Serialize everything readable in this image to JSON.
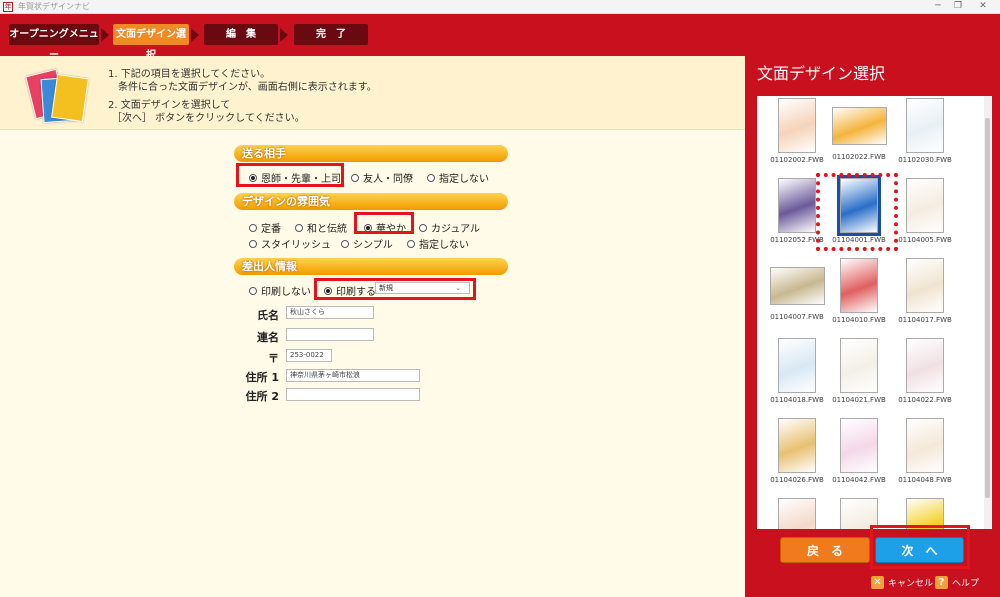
{
  "window": {
    "app_title": "年賀状デザインナビ",
    "minimize": "─",
    "restore": "❐",
    "close": "✕"
  },
  "steps": [
    {
      "label": "オープニングメニュー",
      "active": false
    },
    {
      "label": "文面デザイン選択",
      "active": true
    },
    {
      "label": "編　集",
      "active": false
    },
    {
      "label": "完　了",
      "active": false
    }
  ],
  "instructions": {
    "line1": "1. 下記の項目を選択してください。",
    "line2": "条件に合った文面デザインが、画面右側に表示されます。",
    "line3": "2. 文面デザインを選択して",
    "line4": "［次へ］ ボタンをクリックしてください。"
  },
  "recipient": {
    "title": "送る相手",
    "options": [
      {
        "label": "恩師・先輩・上司",
        "checked": true
      },
      {
        "label": "友人・同僚",
        "checked": false
      },
      {
        "label": "指定しない",
        "checked": false
      }
    ]
  },
  "mood": {
    "title": "デザインの雰囲気",
    "options": [
      {
        "label": "定番",
        "checked": false
      },
      {
        "label": "和と伝統",
        "checked": false
      },
      {
        "label": "華やか",
        "checked": true
      },
      {
        "label": "カジュアル",
        "checked": false
      },
      {
        "label": "スタイリッシュ",
        "checked": false
      },
      {
        "label": "シンプル",
        "checked": false
      },
      {
        "label": "指定しない",
        "checked": false
      }
    ]
  },
  "sender": {
    "title": "差出人情報",
    "no_print": "印刷しない",
    "print": "印刷する",
    "print_selected": true,
    "select_value": "新規",
    "fields": [
      {
        "label": "氏名",
        "value": "秋山さくら"
      },
      {
        "label": "連名",
        "value": ""
      },
      {
        "label": "〒",
        "value": "253-0022"
      },
      {
        "label": "住所 1",
        "value": "神奈川県茅ヶ崎市松浪"
      },
      {
        "label": "住所 2",
        "value": ""
      }
    ]
  },
  "panel": {
    "title": "文面デザイン選択",
    "thumbs": [
      {
        "name": "01102002.FWB",
        "color": "#f6d3b8",
        "land": false
      },
      {
        "name": "01102022.FWB",
        "color": "#f4b43c",
        "land": true
      },
      {
        "name": "01102030.FWB",
        "color": "#e8f0f4",
        "land": false
      },
      {
        "name": "01102052.FWB",
        "color": "#6a5a9a",
        "land": false
      },
      {
        "name": "01104001.FWB",
        "color": "#2a6fc8",
        "land": false,
        "selected": true
      },
      {
        "name": "01104005.FWB",
        "color": "#f4ece0",
        "land": false
      },
      {
        "name": "01104007.FWB",
        "color": "#c8b890",
        "land": true
      },
      {
        "name": "01104010.FWB",
        "color": "#e06060",
        "land": false
      },
      {
        "name": "01104017.FWB",
        "color": "#f0e4d0",
        "land": false
      },
      {
        "name": "01104018.FWB",
        "color": "#d8e8f4",
        "land": false
      },
      {
        "name": "01104021.FWB",
        "color": "#f4f0e8",
        "land": false
      },
      {
        "name": "01104022.FWB",
        "color": "#f0e0e4",
        "land": false
      },
      {
        "name": "01104026.FWB",
        "color": "#e8c070",
        "land": false
      },
      {
        "name": "01104042.FWB",
        "color": "#f4d8e8",
        "land": false
      },
      {
        "name": "01104048.FWB",
        "color": "#f4e8d8",
        "land": false
      },
      {
        "name": "",
        "color": "#f4d8c8",
        "land": false
      },
      {
        "name": "",
        "color": "#f4ece0",
        "land": false
      },
      {
        "name": "",
        "color": "#f4d020",
        "land": false
      }
    ],
    "back": "戻　る",
    "next": "次　へ",
    "cancel": "キャンセル",
    "help": "ヘルプ",
    "cancel_icon": "✕",
    "help_icon": "?"
  }
}
